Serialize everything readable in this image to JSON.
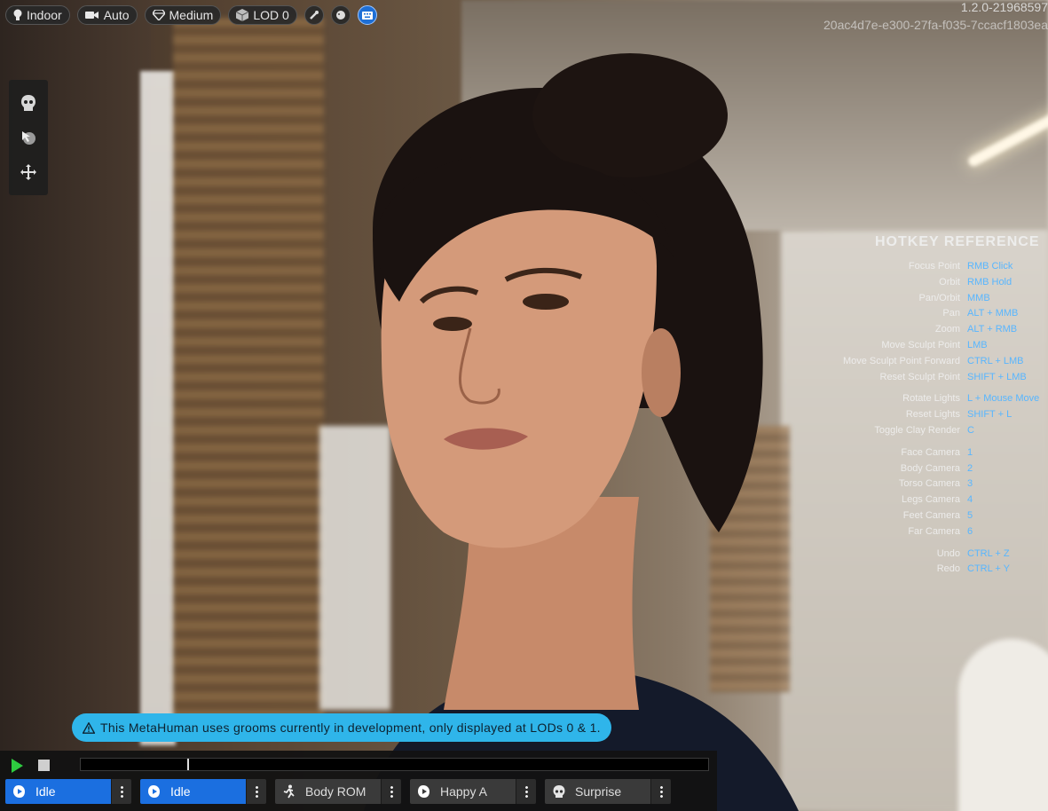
{
  "toolbar": {
    "lighting_label": "Indoor",
    "camera_label": "Auto",
    "quality_label": "Medium",
    "lod_label": "LOD 0"
  },
  "version": {
    "line1": "1.2.0-21968597",
    "line2": "20ac4d7e-e300-27fa-f035-7ccacf1803ea"
  },
  "left_tools": [
    "skull-icon",
    "sculpt-cursor-icon",
    "move-icon"
  ],
  "hotkeys": {
    "title": "HOTKEY REFERENCE",
    "groups": [
      [
        {
          "action": "Focus Point",
          "key": "RMB Click"
        },
        {
          "action": "Orbit",
          "key": "RMB Hold"
        },
        {
          "action": "Pan/Orbit",
          "key": "MMB"
        },
        {
          "action": "Pan",
          "key": "ALT + MMB"
        },
        {
          "action": "Zoom",
          "key": "ALT + RMB"
        },
        {
          "action": "Move Sculpt Point",
          "key": "LMB"
        },
        {
          "action": "Move Sculpt Point Forward",
          "key": "CTRL + LMB"
        },
        {
          "action": "Reset Sculpt Point",
          "key": "SHIFT + LMB"
        }
      ],
      [
        {
          "action": "Rotate Lights",
          "key": "L + Mouse Move"
        },
        {
          "action": "Reset Lights",
          "key": "SHIFT + L"
        },
        {
          "action": "Toggle Clay Render",
          "key": "C"
        }
      ],
      [
        {
          "action": "Face Camera",
          "key": "1"
        },
        {
          "action": "Body Camera",
          "key": "2"
        },
        {
          "action": "Torso Camera",
          "key": "3"
        },
        {
          "action": "Legs Camera",
          "key": "4"
        },
        {
          "action": "Feet Camera",
          "key": "5"
        },
        {
          "action": "Far Camera",
          "key": "6"
        }
      ],
      [
        {
          "action": "Undo",
          "key": "CTRL + Z"
        },
        {
          "action": "Redo",
          "key": "CTRL + Y"
        }
      ]
    ]
  },
  "notice": {
    "text": "This MetaHuman uses grooms currently in development, only displayed at LODs 0 & 1."
  },
  "timeline": {
    "progress": 0.17
  },
  "animations": [
    {
      "label": "Idle",
      "icon": "face-play-icon",
      "active": true
    },
    {
      "label": "Idle",
      "icon": "face-play-icon",
      "active": true
    },
    {
      "label": "Body ROM",
      "icon": "running-figure-icon",
      "active": false
    },
    {
      "label": "Happy A",
      "icon": "face-play-icon",
      "active": false
    },
    {
      "label": "Surprise",
      "icon": "skull-icon",
      "active": false
    }
  ],
  "colors": {
    "accent": "#1b6fe0",
    "notice_bg": "#2fb5ea",
    "hotkey_key": "#58b6ff",
    "play_green": "#2ecc40"
  }
}
